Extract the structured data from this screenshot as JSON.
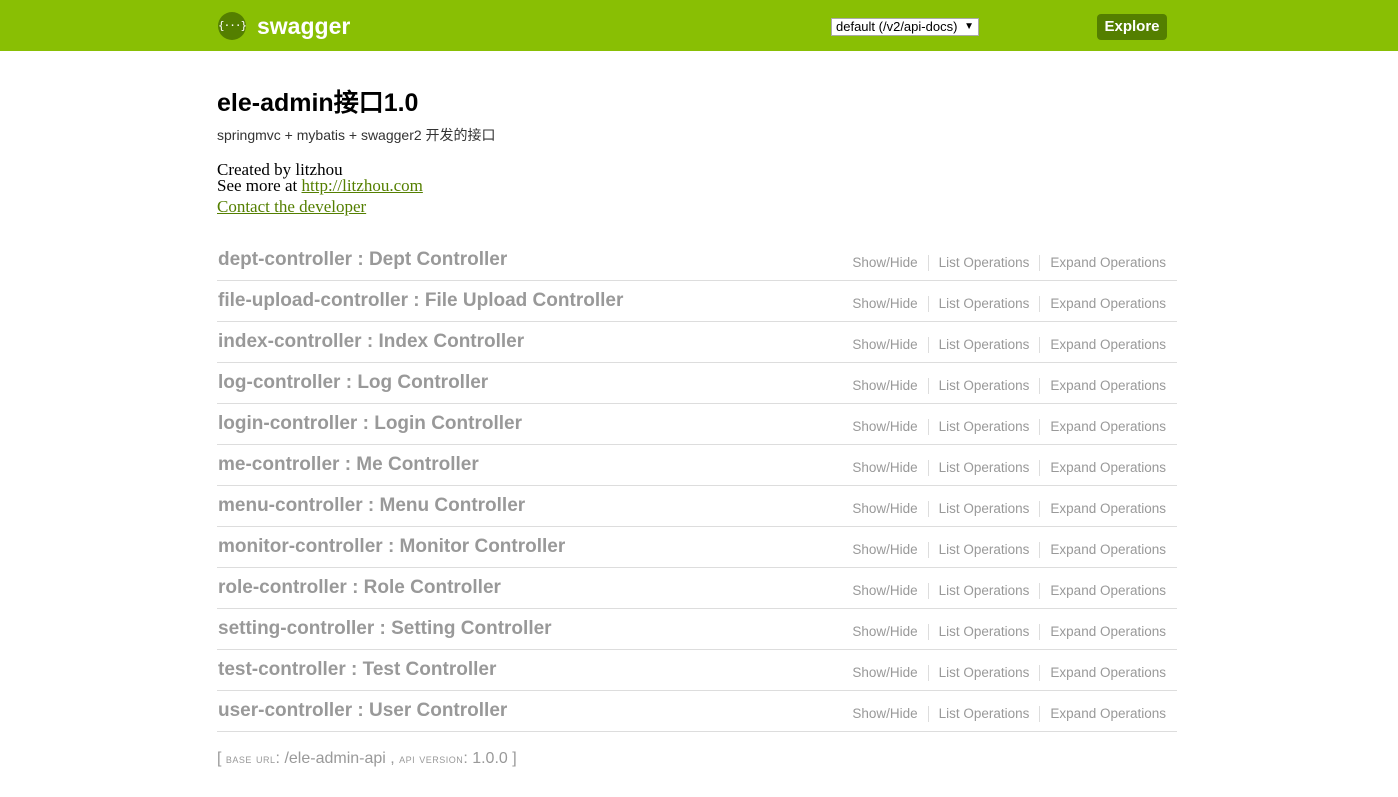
{
  "header": {
    "logo_icon_text": "{···}",
    "logo_text": "swagger",
    "api_select_value": "default (/v2/api-docs)",
    "explore_label": "Explore",
    "brand_color": "#89bf04",
    "button_color": "#547f00"
  },
  "info": {
    "title": "ele-admin接口1.0",
    "description": "springmvc + mybatis + swagger2 开发的接口",
    "created_by": "Created by litzhou",
    "see_more_prefix": "See more at",
    "see_more_link": "http://litzhou.com",
    "contact_label": "Contact the developer"
  },
  "operations_labels": {
    "show_hide": "Show/Hide",
    "list": "List Operations",
    "expand": "Expand Operations"
  },
  "resources": [
    {
      "title": "dept-controller : Dept Controller"
    },
    {
      "title": "file-upload-controller : File Upload Controller"
    },
    {
      "title": "index-controller : Index Controller"
    },
    {
      "title": "log-controller : Log Controller"
    },
    {
      "title": "login-controller : Login Controller"
    },
    {
      "title": "me-controller : Me Controller"
    },
    {
      "title": "menu-controller : Menu Controller"
    },
    {
      "title": "monitor-controller : Monitor Controller"
    },
    {
      "title": "role-controller : Role Controller"
    },
    {
      "title": "setting-controller : Setting Controller"
    },
    {
      "title": "test-controller : Test Controller"
    },
    {
      "title": "user-controller : User Controller"
    }
  ],
  "footer": {
    "open_bracket": "[",
    "base_url_label": "base url",
    "base_url_value": "/ele-admin-api",
    "api_version_label": "api version",
    "api_version_value": "1.0.0",
    "close_bracket": "]"
  }
}
